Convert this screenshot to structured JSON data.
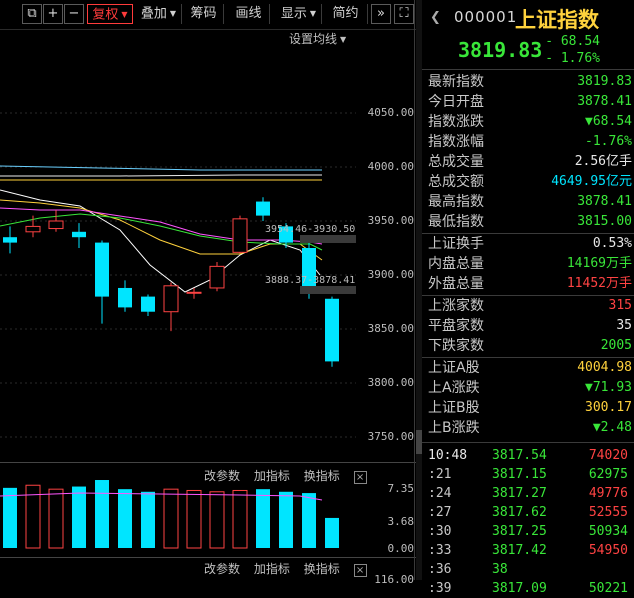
{
  "toolbar": {
    "items": [
      {
        "label": "复权",
        "active": true,
        "dropdown": true
      },
      {
        "label": "叠加",
        "active": false,
        "dropdown": true
      },
      {
        "label": "筹码",
        "active": false,
        "dropdown": false
      },
      {
        "label": "画线",
        "active": false,
        "dropdown": false
      },
      {
        "label": "显示",
        "active": false,
        "dropdown": true
      },
      {
        "label": "简约",
        "active": false,
        "dropdown": false
      }
    ],
    "ma_settings": "设置均线"
  },
  "chart": {
    "price_axis": [
      "4050.00",
      "4000.00",
      "3950.00",
      "3900.00",
      "3850.00",
      "3800.00",
      "3750.00"
    ],
    "annotations": {
      "upper": "3954.46-3930.50",
      "lower": "3888.37-3878.41"
    },
    "sub_axis": [
      "7.35",
      "3.68",
      "0.00"
    ],
    "sub_bottom_label": "116.00"
  },
  "sub_tabs": {
    "change_params": "改参数",
    "add_indicator": "加指标",
    "swap_indicator": "换指标",
    "close": "×"
  },
  "chart_data": {
    "type": "candlestick",
    "candles": [
      {
        "o": 3935,
        "c": 3930,
        "h": 3945,
        "l": 3920
      },
      {
        "o": 3940,
        "c": 3945,
        "h": 3955,
        "l": 3935
      },
      {
        "o": 3943,
        "c": 3950,
        "h": 3960,
        "l": 3940
      },
      {
        "o": 3940,
        "c": 3935,
        "h": 3948,
        "l": 3925
      },
      {
        "o": 3930,
        "c": 3880,
        "h": 3932,
        "l": 3855
      },
      {
        "o": 3888,
        "c": 3870,
        "h": 3895,
        "l": 3866
      },
      {
        "o": 3880,
        "c": 3866,
        "h": 3882,
        "l": 3862
      },
      {
        "o": 3866,
        "c": 3890,
        "h": 3893,
        "l": 3848
      },
      {
        "o": 3884,
        "c": 3884,
        "h": 3888,
        "l": 3878
      },
      {
        "o": 3888,
        "c": 3908,
        "h": 3912,
        "l": 3885
      },
      {
        "o": 3921,
        "c": 3952,
        "h": 3955,
        "l": 3920
      },
      {
        "o": 3968,
        "c": 3955,
        "h": 3972,
        "l": 3950
      },
      {
        "o": 3945,
        "c": 3930,
        "h": 3948,
        "l": 3925
      },
      {
        "o": 3925,
        "c": 3888,
        "h": 3930,
        "l": 3878
      },
      {
        "o": 3878,
        "c": 3820,
        "h": 3880,
        "l": 3815
      }
    ],
    "volume": [
      4.6,
      4.8,
      4.5,
      4.7,
      5.2,
      4.5,
      4.3,
      4.5,
      4.4,
      4.3,
      4.4,
      4.5,
      4.3,
      4.2,
      2.3
    ],
    "volume_ylim": [
      0,
      7.35
    ]
  },
  "quote": {
    "code": "000001",
    "name": "上证指数",
    "price": "3819.83",
    "change": "- 68.54",
    "change_pct": "- 1.76%",
    "rows": [
      {
        "label": "最新指数",
        "value": "3819.83",
        "color": "g"
      },
      {
        "label": "今日开盘",
        "value": "3878.41",
        "color": "g"
      },
      {
        "label": "指数涨跌",
        "value": "▼68.54",
        "color": "g"
      },
      {
        "label": "指数涨幅",
        "value": "-1.76%",
        "color": "g"
      },
      {
        "label": "总成交量",
        "value": "2.56亿手",
        "color": "w"
      },
      {
        "label": "总成交额",
        "value": "4649.95亿元",
        "color": "c"
      },
      {
        "label": "最高指数",
        "value": "3878.41",
        "color": "g"
      },
      {
        "label": "最低指数",
        "value": "3815.00",
        "color": "g"
      },
      {
        "label": "上证换手",
        "value": "0.53%",
        "color": "w"
      },
      {
        "label": "内盘总量",
        "value": "14169万手",
        "color": "g"
      },
      {
        "label": "外盘总量",
        "value": "11452万手",
        "color": "r"
      },
      {
        "label": "上涨家数",
        "value": "315",
        "color": "r"
      },
      {
        "label": "平盘家数",
        "value": "35",
        "color": "w"
      },
      {
        "label": "下跌家数",
        "value": "2005",
        "color": "g"
      },
      {
        "label": "上证A股",
        "value": "4004.98",
        "color": "y"
      },
      {
        "label": "上A涨跌",
        "value": "▼71.93",
        "color": "g"
      },
      {
        "label": "上证B股",
        "value": "300.17",
        "color": "y"
      },
      {
        "label": "上B涨跌",
        "value": "▼2.48",
        "color": "g"
      }
    ],
    "ticks": [
      {
        "time": "10:48",
        "price": "3817.54",
        "vol": "74020",
        "color": "r"
      },
      {
        "time": ":21",
        "price": "3817.15",
        "vol": "62975",
        "color": "g"
      },
      {
        "time": ":24",
        "price": "3817.27",
        "vol": "49776",
        "color": "r"
      },
      {
        "time": ":27",
        "price": "3817.62",
        "vol": "52555",
        "color": "r"
      },
      {
        "time": ":30",
        "price": "3817.25",
        "vol": "50934",
        "color": "g"
      },
      {
        "time": ":33",
        "price": "3817.42",
        "vol": "54950",
        "color": "r"
      },
      {
        "time": ":36",
        "price": "38",
        "vol": "",
        "color": "w"
      },
      {
        "time": ":39",
        "price": "3817.09",
        "vol": "50221",
        "color": "g"
      }
    ]
  }
}
